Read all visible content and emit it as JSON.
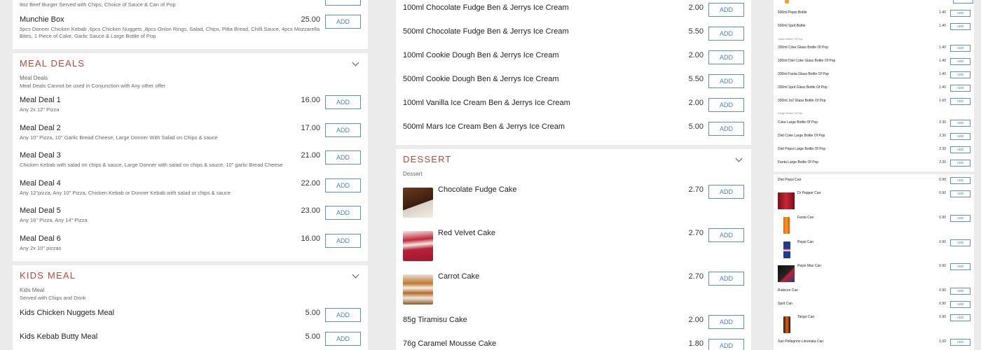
{
  "left": {
    "top_desc": "8oz Beef Burger Served with Chips, Choice of Sauce & Can of Pop",
    "top_item": {
      "name": "Munchie Box",
      "desc1": "5pcs Donner Chicken Kebab ,6pcs Chicken Nuggets ,8pcs Onion Rings, Salad, Chips, Pitta Bread, Chilli Sauce, 4pcs Mozzarella",
      "desc2": "Bites, 1 Piece of Cake, Garlic Sauce & Large Bottle of Pop",
      "price": "25.00"
    },
    "meal_deals": {
      "title": "MEAL DEALS",
      "subtitle": "Meal Deals",
      "note": "Meal Deals Cannot be used in Conjunction with Any other offer",
      "items": [
        {
          "name": "Meal Deal 1",
          "desc": "Any 2x 12\" Pizza",
          "price": "16.00"
        },
        {
          "name": "Meal Deal 2",
          "desc": "Any 10\" Pizza, 10\" Garlic Bread Cheese, Large Donner With Salad on Chips & sauce",
          "price": "17.00"
        },
        {
          "name": "Meal Deal 3",
          "desc": "Chicken Kebab with salad on chips & sauce, Large Donner with salad on chips & sauce, 10\" garlic Bread Cheese",
          "price": "21.00"
        },
        {
          "name": "Meal Deal 4",
          "desc": "Any 12\"pizza, Any 10\" Pizza, Chicken Kebab or Donner Kebab with salad or chips & sauce",
          "price": "22.00"
        },
        {
          "name": "Meal Deal 5",
          "desc": "Any 16\" Pizza, Any 14\" Pizza",
          "price": "23.00"
        },
        {
          "name": "Meal Deal 6",
          "desc": "Any 2x 10\" pizzas",
          "price": "16.00"
        }
      ]
    },
    "kids_meal": {
      "title": "KIDS MEAL",
      "subtitle": "Kids Meal",
      "note": "Served with Chips and Drink",
      "items": [
        {
          "name": "Kids Chicken Nuggets Meal",
          "price": "5.00"
        },
        {
          "name": "Kids Kebab Butty Meal",
          "price": "5.00"
        }
      ]
    }
  },
  "middle": {
    "ice_cream": [
      {
        "name": "100ml Chocolate Fudge Ben & Jerrys Ice Cream",
        "price": "2.00"
      },
      {
        "name": "500ml Chocolate Fudge Ben & Jerrys Ice Cream",
        "price": "5.50"
      },
      {
        "name": "100ml Cookie Dough Ben & Jerrys Ice Cream",
        "price": "2.00"
      },
      {
        "name": "500ml Cookie Dough Ben & Jerrys Ice Cream",
        "price": "5.50"
      },
      {
        "name": "100ml Vanilla Ice Cream Ben & Jerrys Ice Cream",
        "price": "2.00"
      },
      {
        "name": "500ml Mars Ice Cream Ben & Jerrys Ice Cream",
        "price": "5.00"
      }
    ],
    "dessert": {
      "title": "DESSERT",
      "subtitle": "Dessert",
      "items": [
        {
          "name": "Chocolate Fudge Cake",
          "price": "2.70"
        },
        {
          "name": "Red Velvet Cake",
          "price": "2.70"
        },
        {
          "name": "Carrot Cake",
          "price": "2.70"
        },
        {
          "name": "85g Tiramisu Cake",
          "price": "2.00"
        },
        {
          "name": "76g Caramel Mousse Cake",
          "price": "1.80"
        }
      ]
    }
  },
  "right": {
    "rows1": [
      {
        "name": "500ml Pepsi Bottle",
        "price": "1.40"
      },
      {
        "name": "500ml Sprit Bottle",
        "price": "1.40"
      }
    ],
    "glass_label": "Glass Bottle Of Pop",
    "rows2": [
      {
        "name": "330ml Coke Glass Bottle Of Pop",
        "price": "1.40"
      },
      {
        "name": "330ml Diet Coke Glass Bottle Of Pop",
        "price": "1.40"
      },
      {
        "name": "330ml Fanta Glass Bottle Of Pop",
        "price": "1.40"
      },
      {
        "name": "330ml Sprit Glass Bottle Of Pop",
        "price": "1.40"
      },
      {
        "name": "330ml Jo2 Glass Bottle Of Pop",
        "price": "1.60"
      }
    ],
    "large_label": "Large Bottle Of Pop",
    "rows3": [
      {
        "name": "Coke Large Bottle Of Pop",
        "price": "2.30"
      },
      {
        "name": "Diet Coke Large Bottle Of Pop",
        "price": "2.30"
      },
      {
        "name": "Diet Pepsi Large Bottle Of Pop",
        "price": "2.30"
      },
      {
        "name": "Fanta Large Bottle Of Pop",
        "price": "2.30"
      }
    ],
    "cans": [
      {
        "name": "Diet Pepsi Can",
        "price": "0.90"
      },
      {
        "name": "Dr Pepper Can",
        "price": "0.90"
      },
      {
        "name": "Fanta Can",
        "price": "0.90"
      },
      {
        "name": "Pepsi Can",
        "price": "0.90"
      },
      {
        "name": "Pepsi Max Can",
        "price": "0.90"
      },
      {
        "name": "Rubicon Can",
        "price": "0.90"
      },
      {
        "name": "Sprit Can",
        "price": "0.90"
      },
      {
        "name": "Tango Can",
        "price": "0.90"
      },
      {
        "name": "San Pellegrino Limonata Can",
        "price": "1.00"
      }
    ]
  },
  "add_label": "ADD",
  "colors": {
    "section_title": "#c6433a",
    "add_border": "#5a8fc8",
    "background": "#ebebeb"
  }
}
